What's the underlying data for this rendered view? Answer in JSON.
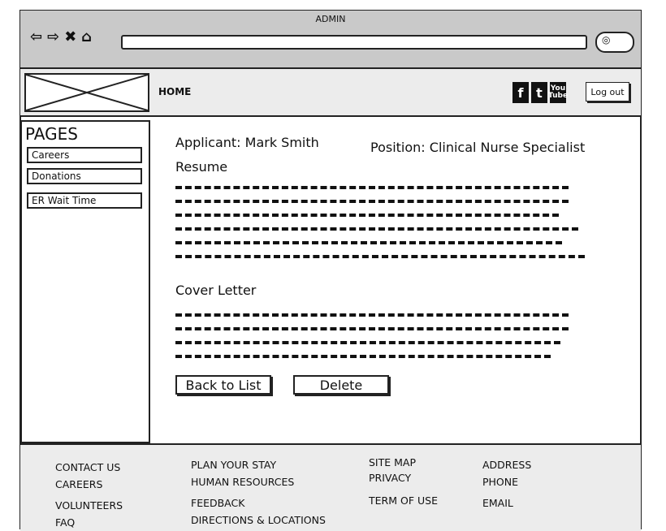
{
  "browser": {
    "title": "ADMIN",
    "nav_icons": [
      "back-arrow-icon",
      "forward-arrow-icon",
      "stop-icon",
      "home-icon"
    ],
    "search_icon": "magnifier-icon"
  },
  "header": {
    "nav_home": "HOME",
    "social": [
      "facebook-icon",
      "twitter-icon",
      "youtube-icon"
    ],
    "logout_label": "Log out"
  },
  "sidebar": {
    "title": "PAGES",
    "items": [
      "Careers",
      "Donations",
      "ER Wait Time"
    ]
  },
  "main": {
    "applicant_label": "Applicant: Mark Smith",
    "position_label": "Position: Clinical Nurse Specialist",
    "resume_heading": "Resume",
    "cover_heading": "Cover Letter",
    "back_button": "Back to List",
    "delete_button": "Delete"
  },
  "footer": {
    "col1": [
      "CONTACT US",
      "CAREERS",
      "VOLUNTEERS",
      "FAQ"
    ],
    "col2": [
      "PLAN YOUR STAY",
      "HUMAN RESOURCES",
      "FEEDBACK",
      "DIRECTIONS & LOCATIONS"
    ],
    "col3": [
      "SITE MAP",
      "PRIVACY",
      "TERM OF USE"
    ],
    "col4": [
      "ADDRESS",
      "PHONE",
      "EMAIL"
    ]
  }
}
